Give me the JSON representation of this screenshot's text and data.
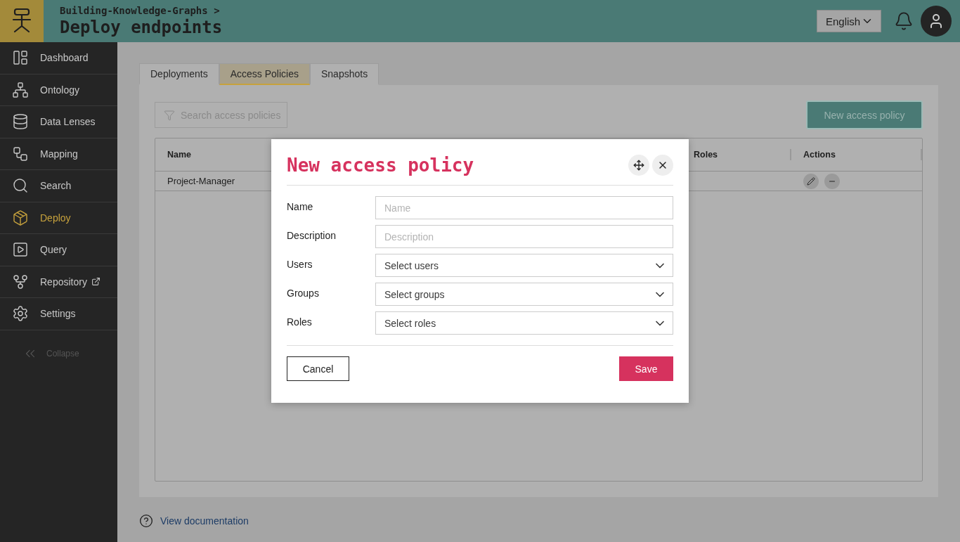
{
  "header": {
    "breadcrumb": "Building-Knowledge-Graphs >",
    "title": "Deploy endpoints",
    "language": "English"
  },
  "sidebar": {
    "items": [
      {
        "label": "Dashboard",
        "selected": false,
        "external": false
      },
      {
        "label": "Ontology",
        "selected": false,
        "external": false
      },
      {
        "label": "Data Lenses",
        "selected": false,
        "external": false
      },
      {
        "label": "Mapping",
        "selected": false,
        "external": false
      },
      {
        "label": "Search",
        "selected": false,
        "external": false
      },
      {
        "label": "Deploy",
        "selected": true,
        "external": false
      },
      {
        "label": "Query",
        "selected": false,
        "external": false
      },
      {
        "label": "Repository",
        "selected": false,
        "external": true
      },
      {
        "label": "Settings",
        "selected": false,
        "external": false
      }
    ],
    "collapse": "Collapse"
  },
  "tabs": [
    {
      "label": "Deployments",
      "selected": false
    },
    {
      "label": "Access Policies",
      "selected": true
    },
    {
      "label": "Snapshots",
      "selected": false
    }
  ],
  "search": {
    "placeholder": "Search access policies"
  },
  "new_button": "New access policy",
  "table": {
    "columns": [
      "Name",
      "Roles",
      "Actions"
    ],
    "rows": [
      {
        "name": "Project-Manager"
      }
    ]
  },
  "documentation_link": "View documentation",
  "dialog": {
    "title": "New access policy",
    "fields": [
      {
        "kind": "text",
        "label": "Name",
        "placeholder": "Name"
      },
      {
        "kind": "text",
        "label": "Description",
        "placeholder": "Description"
      },
      {
        "kind": "select",
        "label": "Users",
        "placeholder": "Select users"
      },
      {
        "kind": "select",
        "label": "Groups",
        "placeholder": "Select groups"
      },
      {
        "kind": "select",
        "label": "Roles",
        "placeholder": "Select roles"
      }
    ],
    "cancel": "Cancel",
    "save": "Save"
  }
}
